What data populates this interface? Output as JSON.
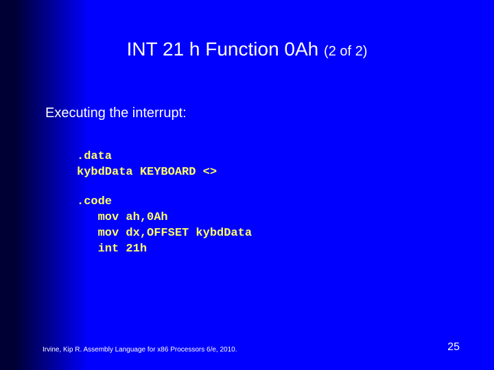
{
  "title_main": "INT 21 h Function 0Ah ",
  "title_sub": "(2 of 2)",
  "body": "Executing the interrupt:",
  "code": {
    "block1": ".data\nkybdData KEYBOARD <>",
    "block2": ".code\n   mov ah,0Ah\n   mov dx,OFFSET kybdData\n   int 21h"
  },
  "footer": "Irvine, Kip R. Assembly Language for x86 Processors 6/e, 2010.",
  "page": "25"
}
